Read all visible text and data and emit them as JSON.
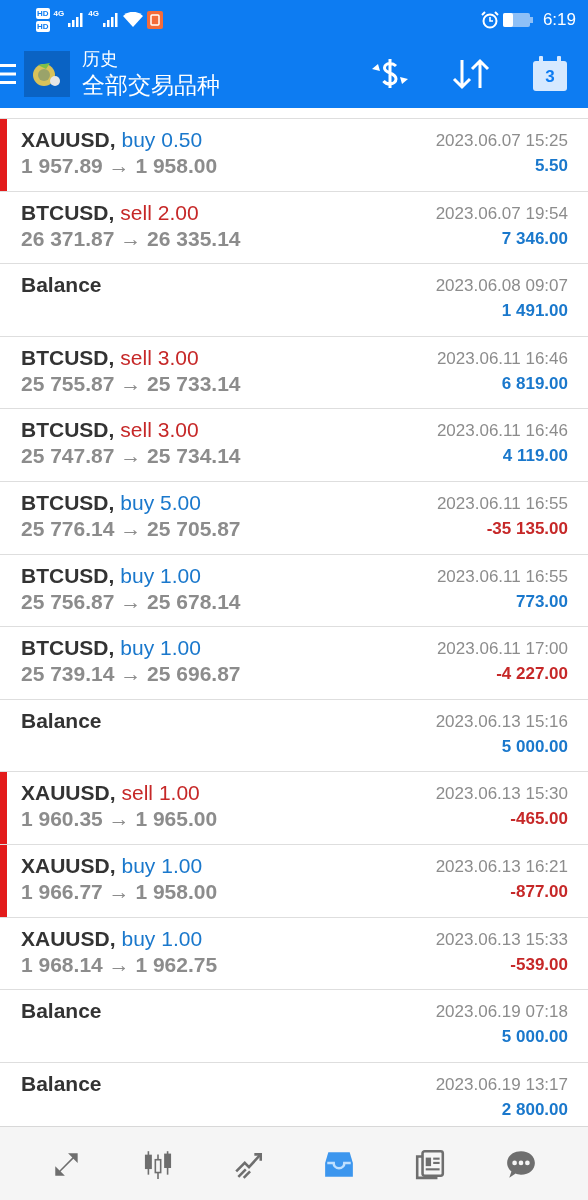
{
  "status_bar": {
    "sim_labels": [
      "HD",
      "HD"
    ],
    "network_labels": [
      "4G",
      "4G"
    ],
    "time": "6:19"
  },
  "header": {
    "title": "历史",
    "subtitle": "全部交易品种",
    "calendar_day": "3"
  },
  "rows": [
    {
      "kind": "trade",
      "symbol": "XAUUSD,",
      "side": "buy",
      "volume": "0.50",
      "sell": false,
      "prices": "1 957.89 → 1 958.00",
      "time": "2023.06.07 15:25",
      "profit": "5.50",
      "loss": false,
      "marked": true
    },
    {
      "kind": "trade",
      "symbol": "BTCUSD,",
      "side": "sell",
      "volume": "2.00",
      "sell": true,
      "prices": "26 371.87 → 26 335.14",
      "time": "2023.06.07 19:54",
      "profit": "7 346.00",
      "loss": false,
      "marked": false
    },
    {
      "kind": "balance",
      "symbol": "Balance",
      "time": "2023.06.08 09:07",
      "profit": "1 491.00",
      "loss": false,
      "marked": false
    },
    {
      "kind": "trade",
      "symbol": "BTCUSD,",
      "side": "sell",
      "volume": "3.00",
      "sell": true,
      "prices": "25 755.87 → 25 733.14",
      "time": "2023.06.11 16:46",
      "profit": "6 819.00",
      "loss": false,
      "marked": false
    },
    {
      "kind": "trade",
      "symbol": "BTCUSD,",
      "side": "sell",
      "volume": "3.00",
      "sell": true,
      "prices": "25 747.87 → 25 734.14",
      "time": "2023.06.11 16:46",
      "profit": "4 119.00",
      "loss": false,
      "marked": false
    },
    {
      "kind": "trade",
      "symbol": "BTCUSD,",
      "side": "buy",
      "volume": "5.00",
      "sell": false,
      "prices": "25 776.14 → 25 705.87",
      "time": "2023.06.11 16:55",
      "profit": "-35 135.00",
      "loss": true,
      "marked": false
    },
    {
      "kind": "trade",
      "symbol": "BTCUSD,",
      "side": "buy",
      "volume": "1.00",
      "sell": false,
      "prices": "25 756.87 → 25 678.14",
      "time": "2023.06.11 16:55",
      "profit": "773.00",
      "loss": false,
      "marked": false
    },
    {
      "kind": "trade",
      "symbol": "BTCUSD,",
      "side": "buy",
      "volume": "1.00",
      "sell": false,
      "prices": "25 739.14 → 25 696.87",
      "time": "2023.06.11 17:00",
      "profit": "-4 227.00",
      "loss": true,
      "marked": false
    },
    {
      "kind": "balance",
      "symbol": "Balance",
      "time": "2023.06.13 15:16",
      "profit": "5 000.00",
      "loss": false,
      "marked": false
    },
    {
      "kind": "trade",
      "symbol": "XAUUSD,",
      "side": "sell",
      "volume": "1.00",
      "sell": true,
      "prices": "1 960.35 → 1 965.00",
      "time": "2023.06.13 15:30",
      "profit": "-465.00",
      "loss": true,
      "marked": true
    },
    {
      "kind": "trade",
      "symbol": "XAUUSD,",
      "side": "buy",
      "volume": "1.00",
      "sell": false,
      "prices": "1 966.77 → 1 958.00",
      "time": "2023.06.13 16:21",
      "profit": "-877.00",
      "loss": true,
      "marked": true
    },
    {
      "kind": "trade",
      "symbol": "XAUUSD,",
      "side": "buy",
      "volume": "1.00",
      "sell": false,
      "prices": "1 968.14 → 1 962.75",
      "time": "2023.06.13 15:33",
      "profit": "-539.00",
      "loss": true,
      "marked": false
    },
    {
      "kind": "balance",
      "symbol": "Balance",
      "time": "2023.06.19 07:18",
      "profit": "5 000.00",
      "loss": false,
      "marked": false
    },
    {
      "kind": "balance",
      "symbol": "Balance",
      "time": "2023.06.19 13:17",
      "profit": "2 800.00",
      "loss": false,
      "marked": false
    }
  ],
  "nav": [
    {
      "kind": "trade",
      "selected": false
    },
    {
      "kind": "quotes",
      "selected": false
    },
    {
      "kind": "chart",
      "selected": false
    },
    {
      "kind": "history",
      "selected": true
    },
    {
      "kind": "news",
      "selected": false
    },
    {
      "kind": "chat",
      "selected": false
    }
  ]
}
